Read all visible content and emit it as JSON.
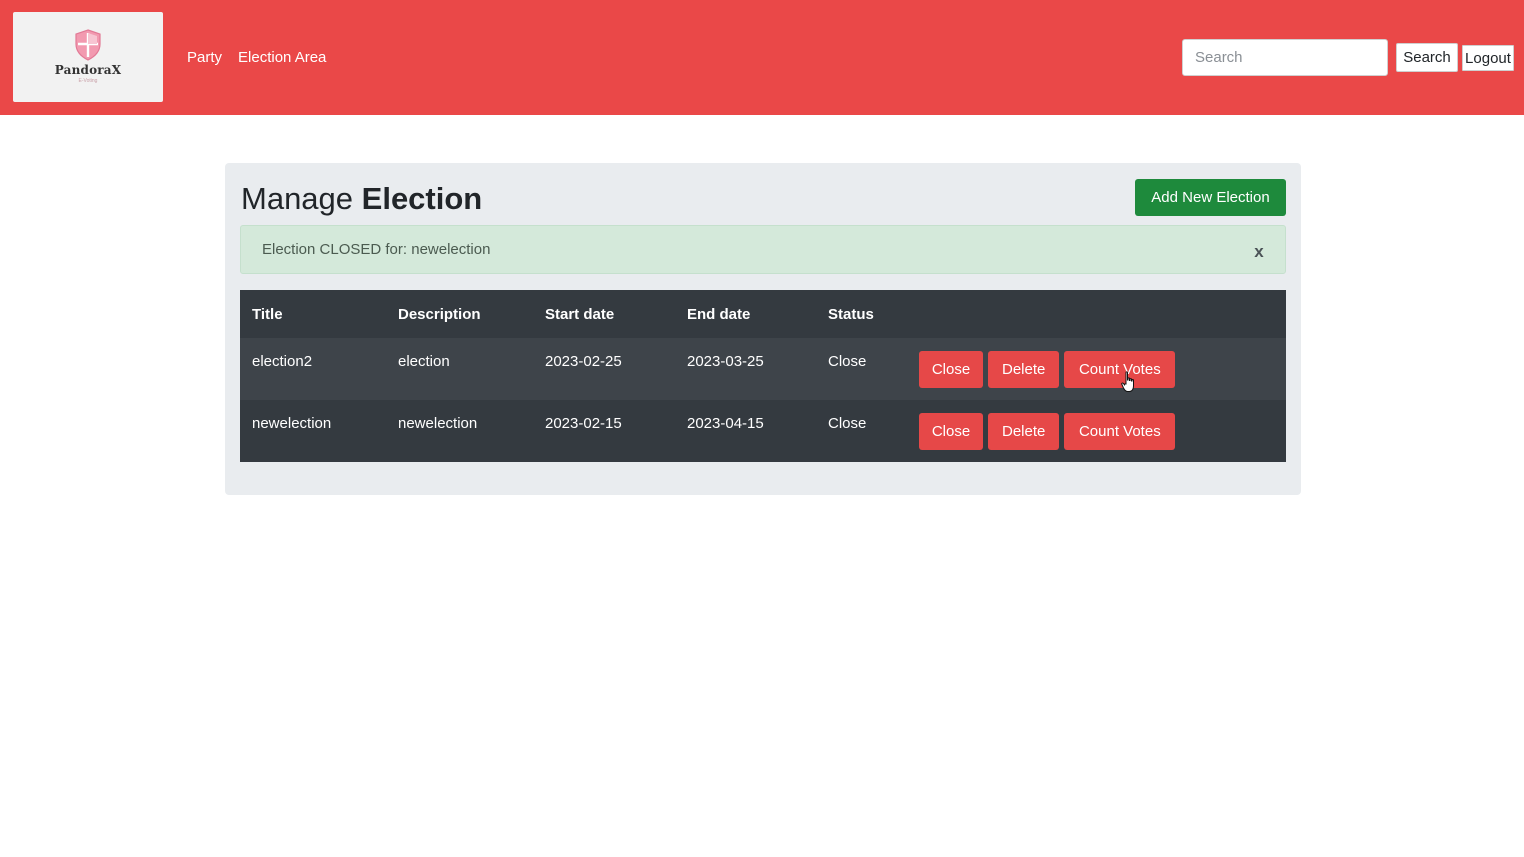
{
  "navbar": {
    "brand_name": "PandoraX",
    "brand_tagline": "E-Voting",
    "links": [
      "Party",
      "Election Area"
    ],
    "search_placeholder": "Search",
    "search_label": "Search",
    "logout_label": "Logout",
    "background_color": "#ea4848"
  },
  "main": {
    "title_light": "Manage",
    "title_bold": "Election",
    "add_button_label": "Add New Election",
    "alert_text": "Election CLOSED for: newelection",
    "alert_close_label": "x",
    "table": {
      "headers": [
        "Title",
        "Description",
        "Start date",
        "End date",
        "Status"
      ],
      "rows": [
        {
          "title": "election2",
          "description": "election",
          "start_date": "2023-02-25",
          "end_date": "2023-03-25",
          "status": "Close",
          "actions": [
            "Close",
            "Delete",
            "Count Votes"
          ]
        },
        {
          "title": "newelection",
          "description": "newelection",
          "start_date": "2023-02-15",
          "end_date": "2023-04-15",
          "status": "Close",
          "actions": [
            "Close",
            "Delete",
            "Count Votes"
          ]
        }
      ]
    },
    "colors": {
      "action_button": "#e64848",
      "add_button": "#1e8a3c",
      "table_header": "#343a40",
      "alert_background": "#d4e9da"
    }
  }
}
